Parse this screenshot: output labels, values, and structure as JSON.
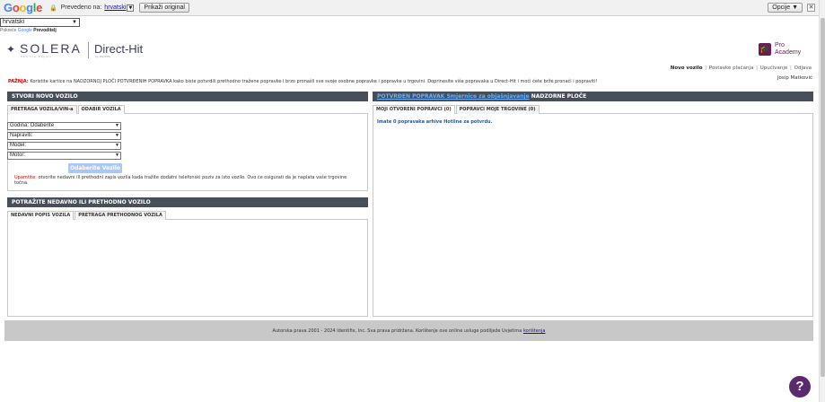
{
  "translate_bar": {
    "logo": "Google",
    "translated_to": "Prevedeno na:",
    "language": "hrvatski",
    "show_original": "Prikaži original",
    "options": "Opcije ▼",
    "close": "✕"
  },
  "language_select": {
    "value": "hrvatski",
    "powered_prefix": "Pokreće",
    "powered_brand": "Google",
    "powered_suffix": "Prevoditelj"
  },
  "header": {
    "solera": "SOLERA",
    "solera_sub": "Vehicle Repair",
    "product": "Direct-Hit",
    "product_sub": "by Identifix",
    "pro_line1": "Pro",
    "pro_line2": "Academy"
  },
  "topnav": {
    "items": [
      "Novo vozilo",
      "Postavke plaćanja",
      "Upućivanje",
      "Odjava"
    ],
    "user": "Josip Matković"
  },
  "notice": {
    "label": "PAŽNJA:",
    "text": "Koristite kartice na NADZORNOJ PLOČI POTVRĐENIH POPRAVKA kako biste potvrdili prethodno tražene popravke i brzo pronašli sve svoje osobne popravke i popravke u trgovini. Doprinesite više popravaka u Direct-Hit i moći ćete brže pronaći i popraviti!"
  },
  "left_panel": {
    "title": "STVORI NOVO VOZILO",
    "tabs": [
      "PRETRAGA VOZILA/VIN-a",
      "ODABIR VOZILA"
    ],
    "selects": [
      "Godina: Odaberite",
      "Napraviti:",
      "Model:",
      "Motor:"
    ],
    "button": "Odaberite Vozilo",
    "warn_label": "Upamtite:",
    "warn_text": "otvorite nedavni ili prethodni zapis vozila kada tražite dodatni telefonski poziv za isto vozilo. Ovo će osigurati da je naplata vaše trgovine točna."
  },
  "recent_panel": {
    "title": "POTRAŽITE NEDAVNO ILI PRETHODNO VOZILO",
    "tabs": [
      "NEDAVNI POPIS VOZILA",
      "PRETRAGA PRETHODNOG VOZILA"
    ]
  },
  "right_panel": {
    "title_link": "POTVRĐEN POPRAVAK Smjernice za objašnjavanje",
    "title_rest": "NADZORNE PLOČE",
    "tab1_label": "MOJI OTVORENI POPRAVCI (",
    "tab1_count": "0",
    "tab1_close": ")",
    "tab2": "POPRAVCI MOJE TRGOVINE (0)",
    "hotline": "Imate 0 popravaka arhive Hotline za potvrdu."
  },
  "footer": {
    "text": "Autorska prava 2001 - 2024 Identifix, Inc. Sva prava pridržana. Korištenje ove online usluge podliježe Uvjetima",
    "link": "korištenja"
  },
  "help": "?"
}
